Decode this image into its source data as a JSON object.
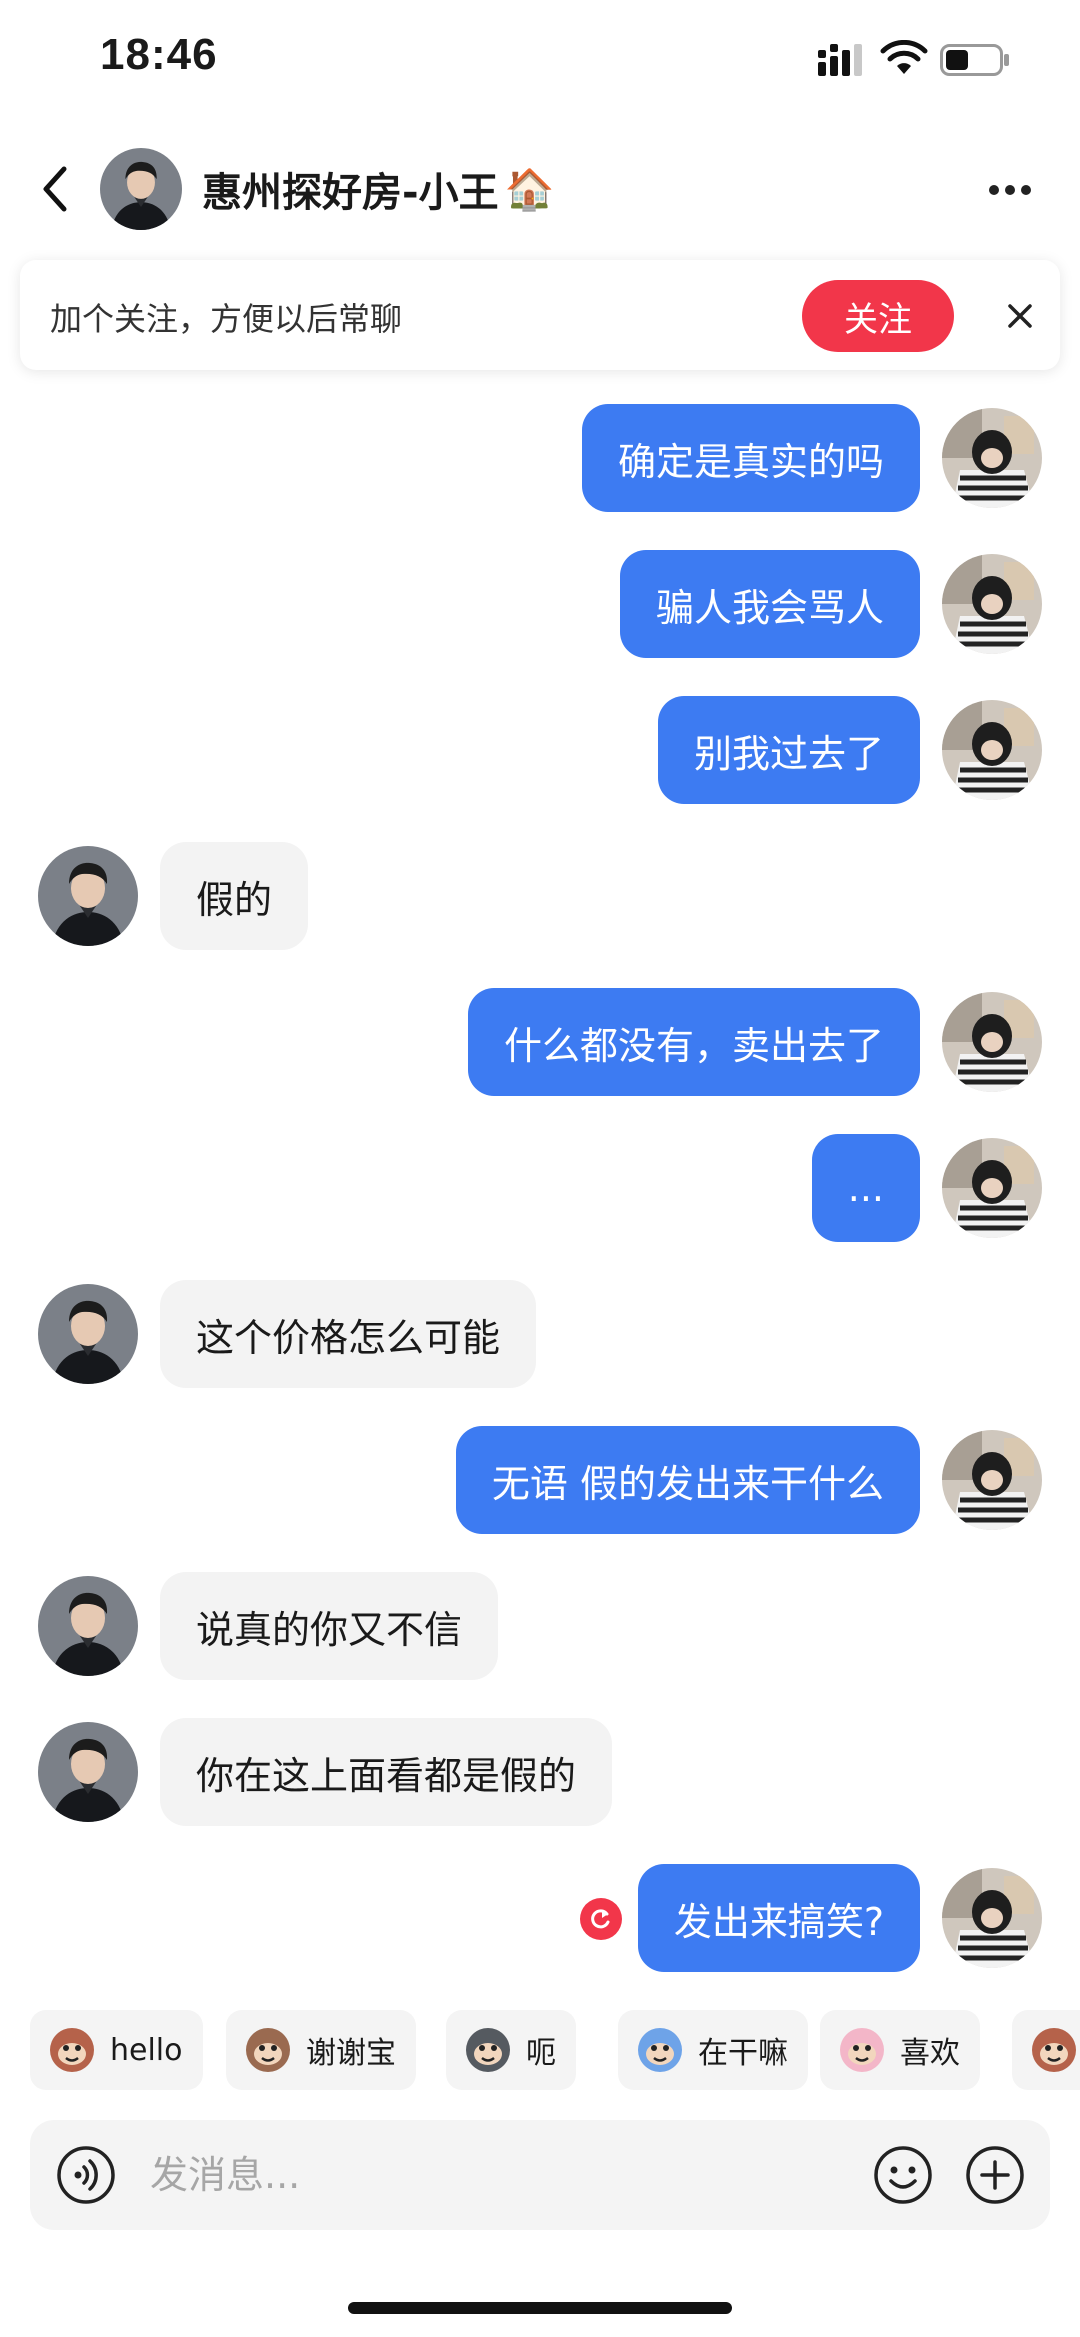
{
  "status_bar": {
    "time": "18:46",
    "icons": [
      "signal-icon",
      "wifi-icon",
      "battery-icon"
    ]
  },
  "header": {
    "title": "惠州探好房-小王",
    "title_emoji": "🏠",
    "back_icon": "chevron-left-icon",
    "more_icon": "more-dots-icon"
  },
  "follow_banner": {
    "text": "加个关注，方便以后常聊",
    "button_label": "关注",
    "close_icon": "close-icon"
  },
  "messages": [
    {
      "side": "out",
      "text": "确定是真实的吗"
    },
    {
      "side": "out",
      "text": "骗人我会骂人"
    },
    {
      "side": "out",
      "text": "别我过去了"
    },
    {
      "side": "in",
      "text": "假的"
    },
    {
      "side": "out",
      "text": "什么都没有，卖出去了"
    },
    {
      "side": "out",
      "text": "..."
    },
    {
      "side": "in",
      "text": "这个价格怎么可能"
    },
    {
      "side": "out",
      "text": "无语 假的发出来干什么"
    },
    {
      "side": "in",
      "text": "说真的你又不信"
    },
    {
      "side": "in",
      "text": "你在这上面看都是假的"
    },
    {
      "side": "out",
      "text": "发出来搞笑?",
      "failed": true
    }
  ],
  "quick_replies": [
    {
      "label": "hello",
      "icon": "monkey-sticker-icon"
    },
    {
      "label": "谢谢宝",
      "icon": "monkey-flower-sticker-icon"
    },
    {
      "label": "呃",
      "icon": "cat-sticker-icon"
    },
    {
      "label": "在干嘛",
      "icon": "fish-sticker-icon"
    },
    {
      "label": "喜欢",
      "icon": "pig-sticker-icon"
    },
    {
      "label": "",
      "icon": "monkey-cover-eyes-sticker-icon"
    }
  ],
  "input_bar": {
    "placeholder": "发消息...",
    "value": "",
    "voice_icon": "voice-icon",
    "emoji_icon": "emoji-icon",
    "plus_icon": "plus-icon"
  },
  "colors": {
    "outgoing_bubble": "#3d7bf2",
    "incoming_bubble": "#f3f3f3",
    "follow_button": "#f2364a",
    "error": "#f2364a"
  }
}
